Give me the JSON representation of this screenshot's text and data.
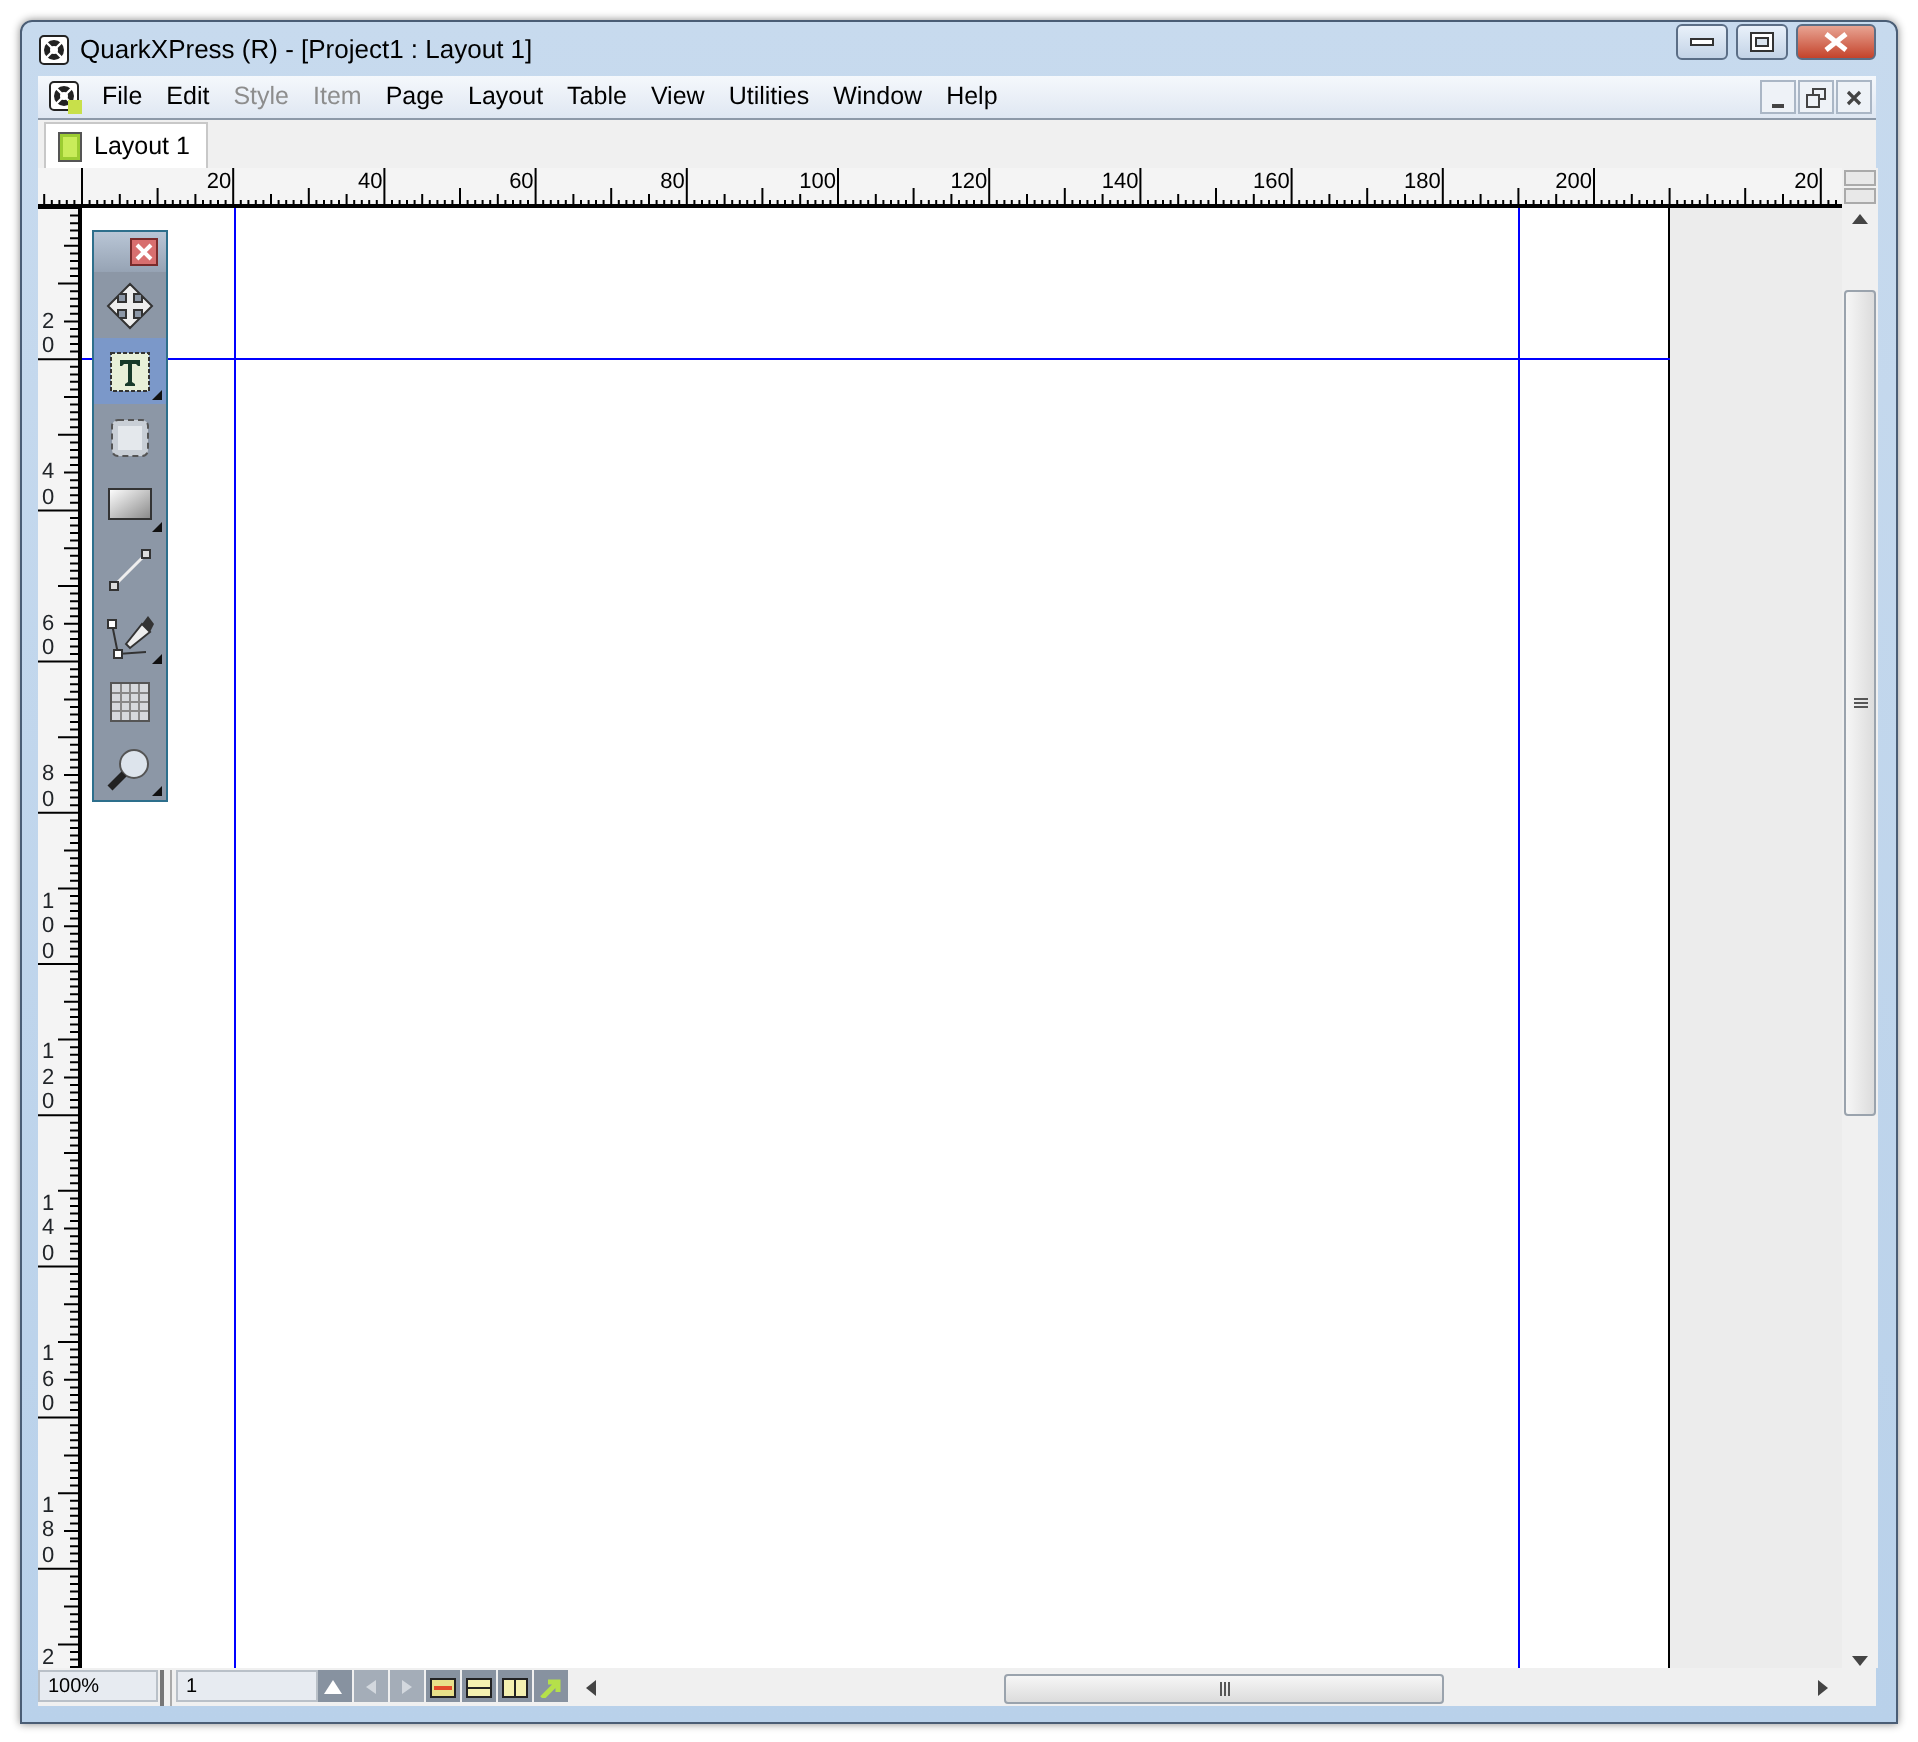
{
  "window": {
    "title": "QuarkXPress (R) - [Project1 : Layout 1]"
  },
  "menu": [
    {
      "label": "File",
      "disabled": false
    },
    {
      "label": "Edit",
      "disabled": false
    },
    {
      "label": "Style",
      "disabled": true
    },
    {
      "label": "Item",
      "disabled": true
    },
    {
      "label": "Page",
      "disabled": false
    },
    {
      "label": "Layout",
      "disabled": false
    },
    {
      "label": "Table",
      "disabled": false
    },
    {
      "label": "View",
      "disabled": false
    },
    {
      "label": "Utilities",
      "disabled": false
    },
    {
      "label": "Window",
      "disabled": false
    },
    {
      "label": "Help",
      "disabled": false
    }
  ],
  "tabs": [
    {
      "label": "Layout 1",
      "selected": true
    }
  ],
  "rulers": {
    "horizontal_labels": [
      "20",
      "40",
      "60",
      "80",
      "100",
      "120",
      "140",
      "160",
      "180",
      "200"
    ],
    "pasteboard_label": "20",
    "vertical_labels": [
      "20",
      "40",
      "60",
      "80",
      "100",
      "120",
      "140",
      "160",
      "180",
      "2"
    ]
  },
  "tools": [
    {
      "kind": "move",
      "selected": false,
      "flyout": false
    },
    {
      "kind": "text",
      "selected": true,
      "flyout": true
    },
    {
      "kind": "picture",
      "selected": false,
      "flyout": false
    },
    {
      "kind": "rectangle",
      "selected": false,
      "flyout": true
    },
    {
      "kind": "line",
      "selected": false,
      "flyout": false
    },
    {
      "kind": "pen",
      "selected": false,
      "flyout": true
    },
    {
      "kind": "table",
      "selected": false,
      "flyout": false
    },
    {
      "kind": "zoom",
      "selected": false,
      "flyout": true
    }
  ],
  "status_bar": {
    "zoom": "100%",
    "page": "1",
    "buttons": [
      {
        "kind": "page-menu",
        "disabled": false
      },
      {
        "kind": "previous",
        "disabled": true
      },
      {
        "kind": "next",
        "disabled": true
      },
      {
        "kind": "layout-view",
        "disabled": false
      },
      {
        "kind": "split-horizontal",
        "disabled": false
      },
      {
        "kind": "split-vertical",
        "disabled": false
      },
      {
        "kind": "export",
        "disabled": false
      }
    ]
  }
}
